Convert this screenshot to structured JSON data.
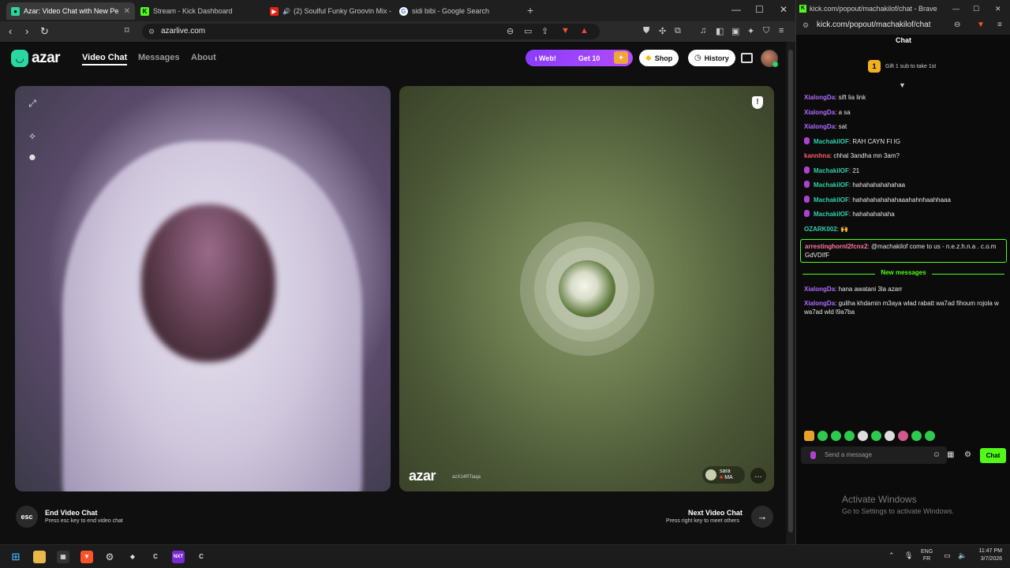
{
  "browser_left": {
    "tabs": [
      {
        "title": "Azar: Video Chat with New Pe",
        "active": true
      },
      {
        "title": "Stream - Kick Dashboard",
        "active": false
      },
      {
        "title": "(2) Soulful Funky Groovin Mix - F",
        "active": false
      },
      {
        "title": "sidi bibi - Google Search",
        "active": false
      }
    ],
    "new_tab": "+",
    "url": "azarlive.com"
  },
  "azar": {
    "logo": "azar",
    "nav": [
      "Video Chat",
      "Messages",
      "About"
    ],
    "promo_left": "ι Web!",
    "promo_right": "Get 10",
    "shop": "Shop",
    "history": "History",
    "peer": {
      "watermark": "azar",
      "watermark_id": "azX14RTiaqa",
      "name": "sara",
      "country": "MA"
    },
    "end": {
      "key": "esc",
      "title": "End Video Chat",
      "sub": "Press esc key to end video chat"
    },
    "next": {
      "title": "Next Video Chat",
      "sub": "Press right key to meet others"
    }
  },
  "chat_window": {
    "title": "kick.com/popout/machakilof/chat - Brave",
    "url": "kick.com/popout/machakilof/chat",
    "header": "Chat",
    "gift_banner": "Gift 1 sub to take 1st",
    "messages": [
      {
        "user": "XialongDa",
        "text": "sift lia link",
        "color": "#b06cff",
        "mic": false
      },
      {
        "user": "XialongDa",
        "text": "a sa",
        "color": "#b06cff",
        "mic": false
      },
      {
        "user": "XialongDa",
        "text": "sat",
        "color": "#b06cff",
        "mic": false
      },
      {
        "user": "MachakilOF",
        "text": "RAH CAYN FI IG",
        "color": "#2fd0a8",
        "mic": true
      },
      {
        "user": "kannhna",
        "text": "chhal 3andha mn 3am?",
        "color": "#ff5a6a",
        "mic": false
      },
      {
        "user": "MachakilOF",
        "text": "21",
        "color": "#2fd0a8",
        "mic": true
      },
      {
        "user": "MachakilOF",
        "text": "hahahahahahahaa",
        "color": "#2fd0a8",
        "mic": true
      },
      {
        "user": "MachakilOF",
        "text": "hahahahahahahaaahahnhaahhaaa",
        "color": "#2fd0a8",
        "mic": true
      },
      {
        "user": "MachakilOF",
        "text": "hahahahahaha",
        "color": "#2fd0a8",
        "mic": true
      },
      {
        "user": "OZARK002",
        "text": "🙌",
        "color": "#2fd0a8",
        "mic": false
      },
      {
        "user": "arrestinghornl2fcnx2",
        "text": "@machakilof come to us - n.e.z.h.n.a . c.o.m GdVDIfF",
        "color": "#ff7a9a",
        "mic": false,
        "highlight": true
      }
    ],
    "new_messages_label": "New messages",
    "new_messages": [
      {
        "user": "XialongDa",
        "text": "hana awatani 3la azarr",
        "color": "#b06cff"
      },
      {
        "user": "XialongDa",
        "text": "guliha khdamin m3aya wlad rabatt wa7ad fihoum rojola w wa7ad wld l9a7ba",
        "color": "#b06cff"
      }
    ],
    "input_placeholder": "Send a message",
    "send_label": "Chat"
  },
  "watermark": {
    "line1": "Activate Windows",
    "line2": "Go to Settings to activate Windows."
  },
  "taskbar": {
    "lang1": "ENG",
    "lang2": "FR",
    "time": "11:47 PM",
    "date": "3/7/2026"
  },
  "colors": {
    "kick_green": "#53fc18",
    "azar_accent": "#28d8a0",
    "promo": "#8a3cff"
  }
}
